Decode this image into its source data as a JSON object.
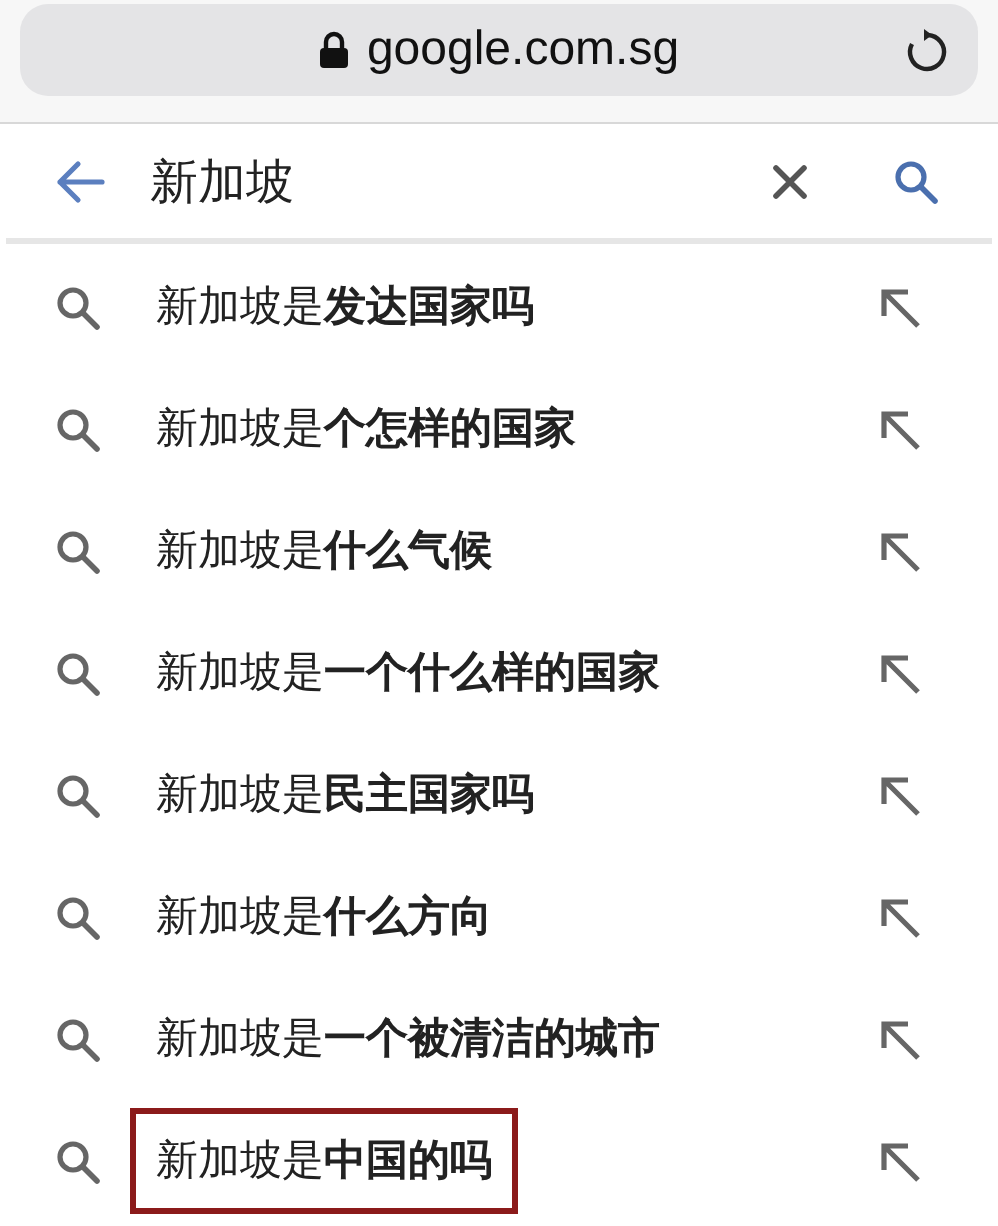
{
  "address_bar": {
    "url": "google.com.sg",
    "secure": true
  },
  "search": {
    "value": "新加坡"
  },
  "suggestions": [
    {
      "text": "新加坡是**发达国家吗**",
      "highlighted": false
    },
    {
      "text": "新加坡是**个怎样的国家**",
      "highlighted": false
    },
    {
      "text": "新加坡是**什么气候**",
      "highlighted": false
    },
    {
      "text": "新加坡是**一个什么样的国家**",
      "highlighted": false
    },
    {
      "text": "新加坡是**民主国家吗**",
      "highlighted": false
    },
    {
      "text": "新加坡是**什么方向**",
      "highlighted": false
    },
    {
      "text": "新加坡是**一个被清洁的城市**",
      "highlighted": false
    },
    {
      "text": "新加坡是**中国的吗**",
      "highlighted": true
    }
  ]
}
